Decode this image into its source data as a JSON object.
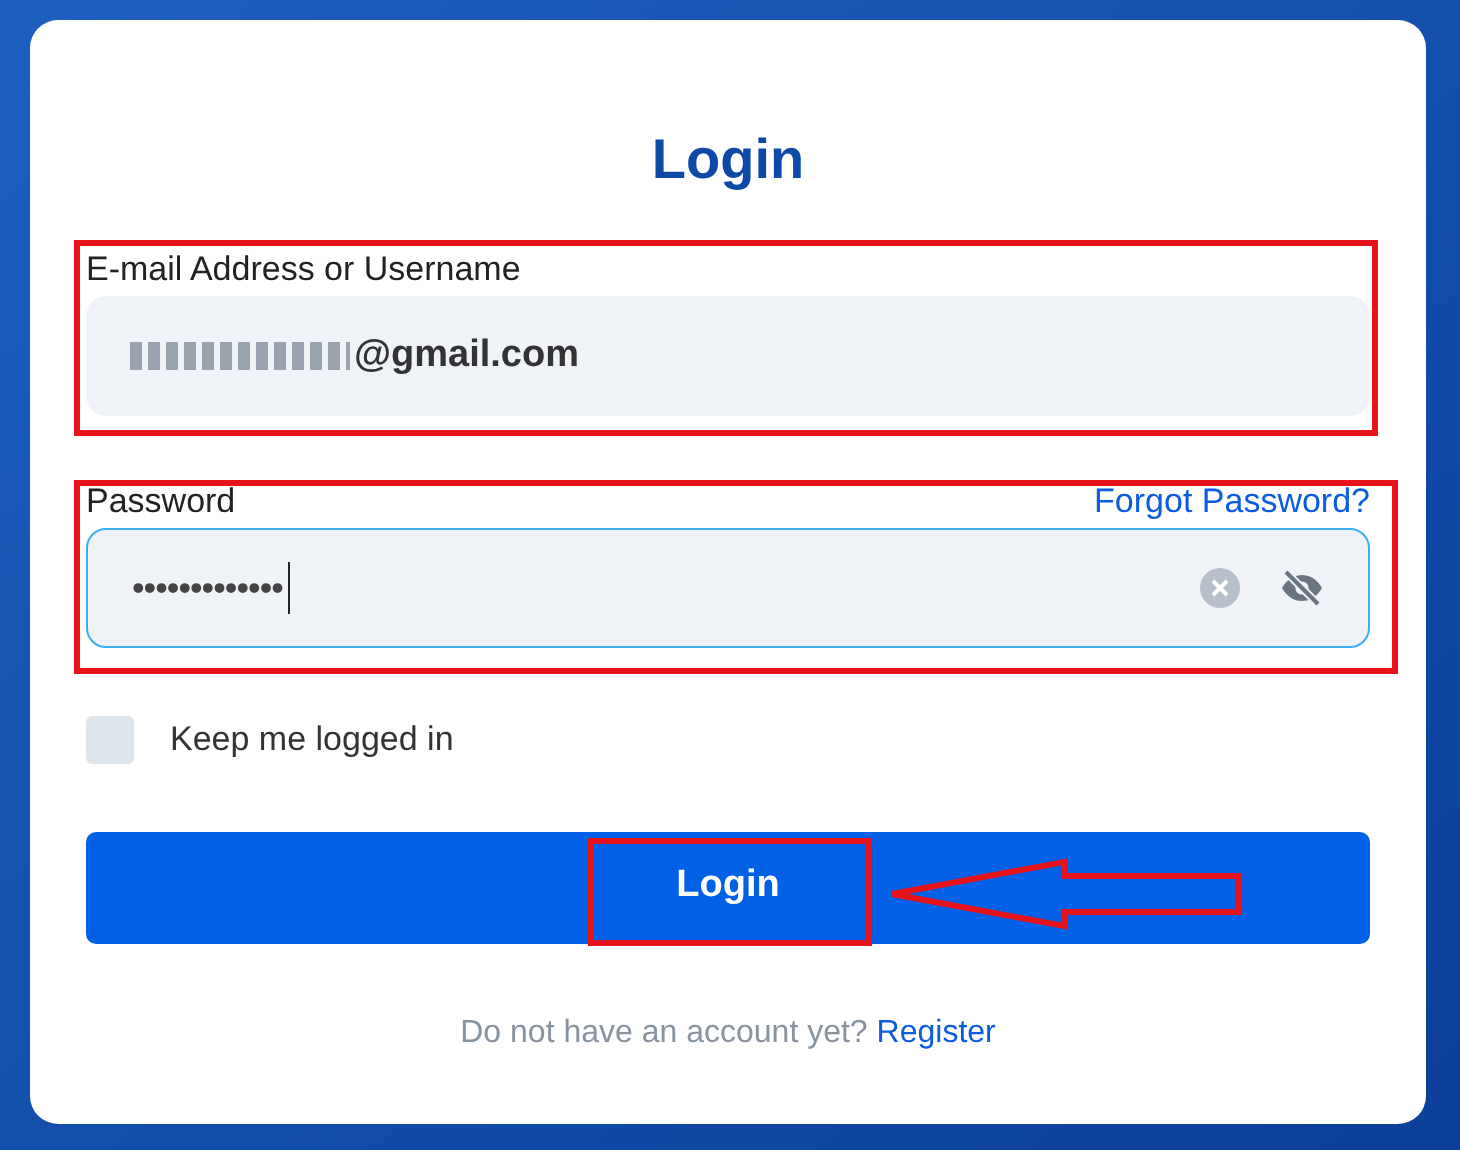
{
  "title": "Login",
  "email": {
    "label": "E-mail Address or Username",
    "value": "@gmail.com",
    "redacted": true
  },
  "password": {
    "label": "Password",
    "forgot_link": "Forgot Password?",
    "value": "•••••••••••••",
    "focused": true
  },
  "keep_logged_in": {
    "label": "Keep me logged in",
    "checked": false
  },
  "login_button": "Login",
  "register": {
    "prompt": "Do not have an account yet?",
    "link": "Register"
  }
}
